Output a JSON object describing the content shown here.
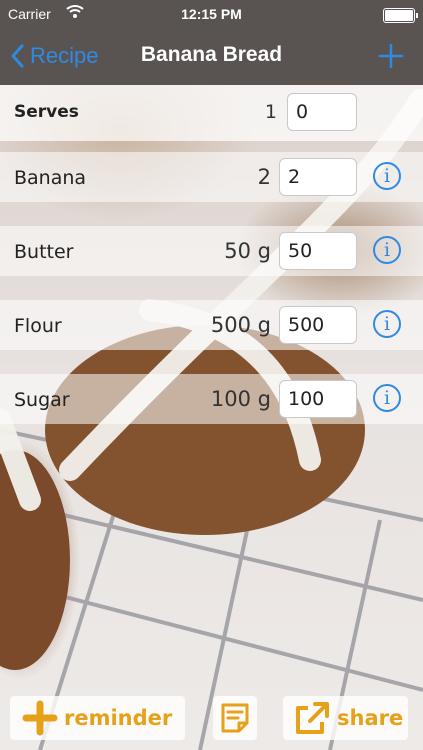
{
  "status_bar": {
    "carrier": "Carrier",
    "time": "12:15 PM"
  },
  "nav": {
    "back_label": "Recipe",
    "title": "Banana Bread"
  },
  "serves": {
    "label": "Serves",
    "base": "1",
    "value": "0"
  },
  "ingredients": [
    {
      "name": "Banana",
      "quantity": "2",
      "value": "2"
    },
    {
      "name": "Butter",
      "quantity": "50 g",
      "value": "50"
    },
    {
      "name": "Flour",
      "quantity": "500 g",
      "value": "500"
    },
    {
      "name": "Sugar",
      "quantity": "100 g",
      "value": "100"
    }
  ],
  "toolbar": {
    "reminder_label": "reminder",
    "share_label": "share"
  },
  "colors": {
    "accent": "#2f8ae4",
    "toolbar_accent": "#e6a11a",
    "bar": "#595452"
  }
}
